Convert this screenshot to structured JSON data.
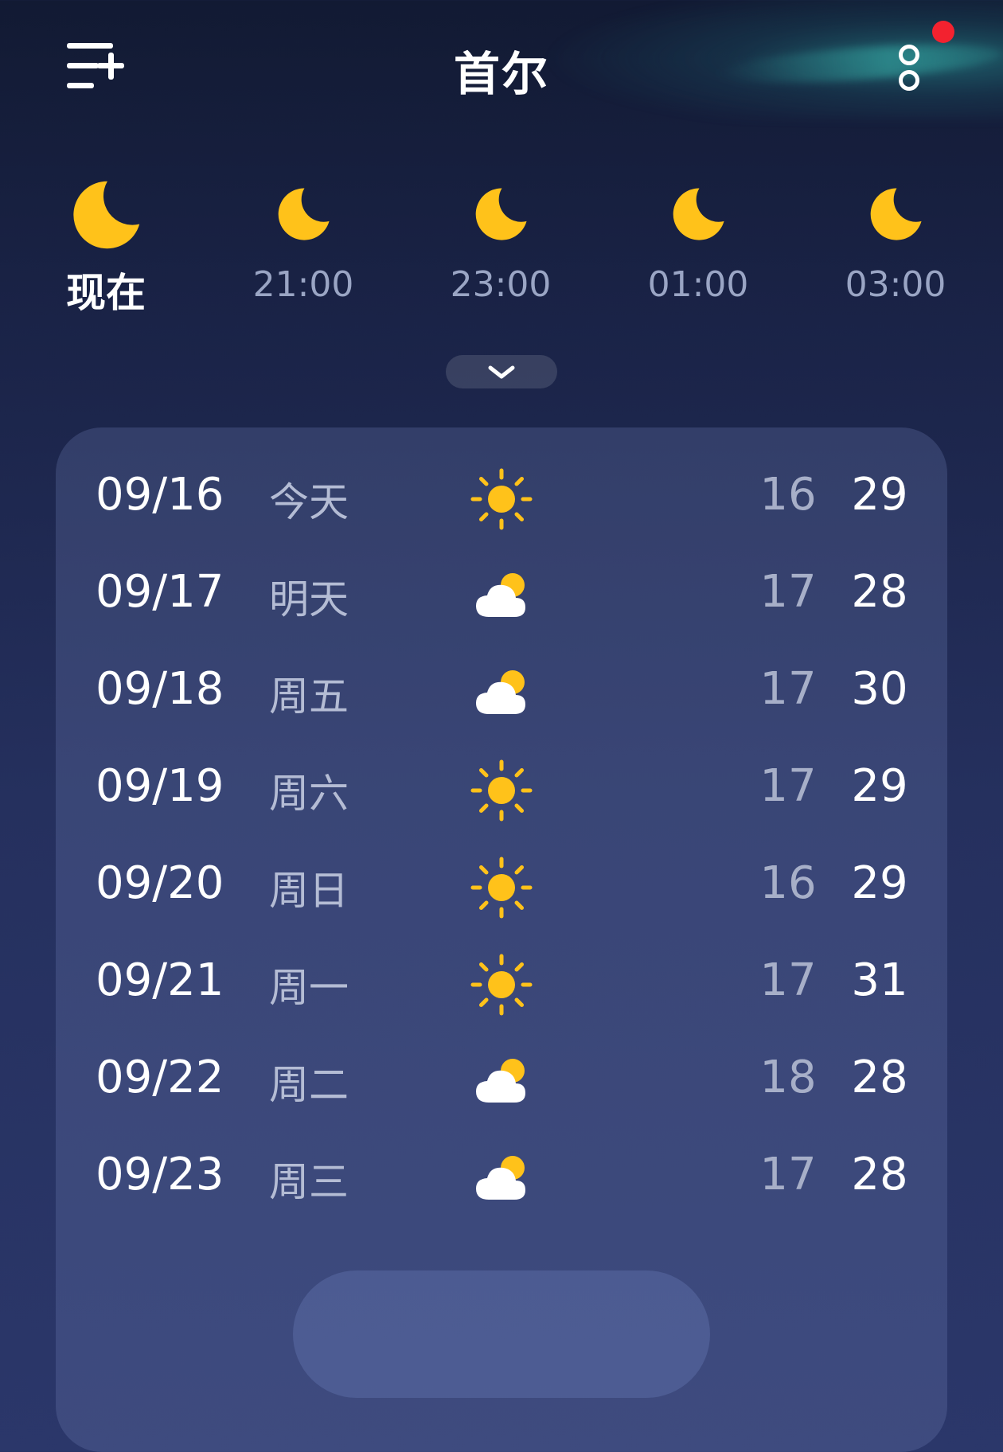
{
  "header": {
    "city": "首尔",
    "menu_icon": "add-city-menu-icon",
    "more_icon": "more-options-icon",
    "notification_color": "#f3222f"
  },
  "hourly": [
    {
      "label": "现在",
      "icon": "moon-icon"
    },
    {
      "label": "21:00",
      "icon": "moon-icon"
    },
    {
      "label": "23:00",
      "icon": "moon-icon"
    },
    {
      "label": "01:00",
      "icon": "moon-icon"
    },
    {
      "label": "03:00",
      "icon": "moon-icon"
    }
  ],
  "expand_icon": "chevron-down-icon",
  "daily": [
    {
      "date": "09/16",
      "day": "今天",
      "icon": "sun-icon",
      "low": "16",
      "high": "29"
    },
    {
      "date": "09/17",
      "day": "明天",
      "icon": "partly-cloudy-icon",
      "low": "17",
      "high": "28"
    },
    {
      "date": "09/18",
      "day": "周五",
      "icon": "partly-cloudy-icon",
      "low": "17",
      "high": "30"
    },
    {
      "date": "09/19",
      "day": "周六",
      "icon": "sun-icon",
      "low": "17",
      "high": "29"
    },
    {
      "date": "09/20",
      "day": "周日",
      "icon": "sun-icon",
      "low": "16",
      "high": "29"
    },
    {
      "date": "09/21",
      "day": "周一",
      "icon": "sun-icon",
      "low": "17",
      "high": "31"
    },
    {
      "date": "09/22",
      "day": "周二",
      "icon": "partly-cloudy-icon",
      "low": "18",
      "high": "28"
    },
    {
      "date": "09/23",
      "day": "周三",
      "icon": "partly-cloudy-icon",
      "low": "17",
      "high": "28"
    }
  ],
  "colors": {
    "sun": "#ffc21a",
    "moon": "#ffc21a",
    "cloud": "#ffffff"
  }
}
